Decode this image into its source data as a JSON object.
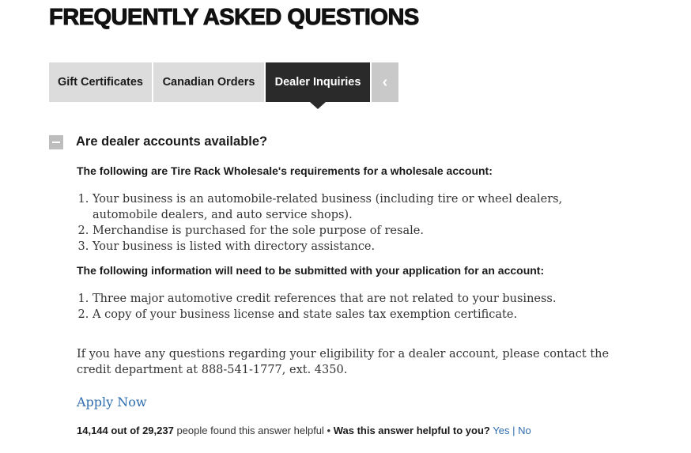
{
  "page": {
    "title": "FREQUENTLY ASKED QUESTIONS"
  },
  "tabs": [
    {
      "label": "Gift Certificates"
    },
    {
      "label": "Canadian Orders"
    },
    {
      "label": "Dealer Inquiries",
      "active": true
    },
    {
      "label": "‹"
    }
  ],
  "faq": {
    "question": "Are dealer accounts available?",
    "intro1": "The following are Tire Rack Wholesale's requirements for a wholesale account:",
    "list1": [
      "Your business is an automobile-related business (including tire or wheel dealers, automobile dealers, and auto service shops).",
      "Merchandise is purchased for the sole purpose of resale.",
      "Your business is listed with directory assistance."
    ],
    "intro2": "The following information will need to be submitted with your application for an account:",
    "list2": [
      "Three major automotive credit references that are not related to your business.",
      "A copy of your business license and state sales tax exemption certificate."
    ],
    "contact": "If you have any questions regarding your eligibility for a dealer account, please contact the credit department at 888-541-1777, ext. 4350.",
    "apply_label": "Apply Now"
  },
  "feedback": {
    "count_text": "14,144 out of 29,237",
    "found_text": " people found this answer helpful • ",
    "question": "Was this answer helpful to you?",
    "yes": "Yes",
    "separator": "|",
    "no": "No"
  },
  "colors": {
    "accent": "#2d6db0",
    "active_tab": "#2a2a2a",
    "tab": "#dcdcdc"
  }
}
